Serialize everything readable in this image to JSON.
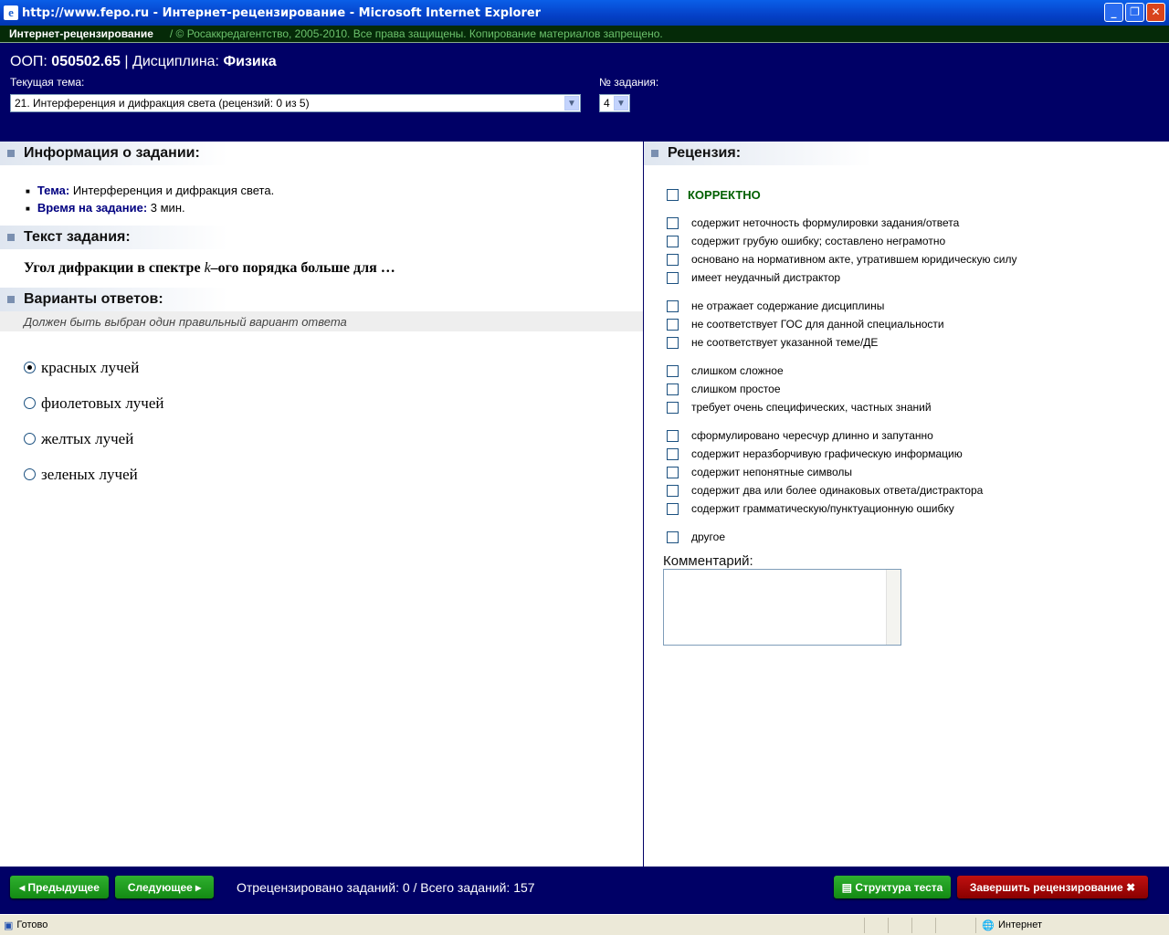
{
  "window": {
    "title": "http://www.fepo.ru - Интернет-рецензирование - Microsoft Internet Explorer"
  },
  "topbar": {
    "app": "Интернет-рецензирование",
    "copyright": "/ © Росаккредагентство, 2005-2010. Все права защищены. Копирование материалов запрещено."
  },
  "header": {
    "oop_label": "ООП:",
    "oop": "050502.65",
    "sep": "|",
    "disc_label": "Дисциплина:",
    "disc": "Физика",
    "topic_label": "Текущая тема:",
    "topic": "21. Интерференция и дифракция света  (рецензий: 0 из 5)",
    "task_label": "№ задания:",
    "task": "4"
  },
  "left": {
    "info_title": "Информация о задании:",
    "topic_key": "Тема:",
    "topic_val": "Интерференция и дифракция света.",
    "time_key": "Время на задание:",
    "time_val": "3 мин.",
    "text_title": "Текст задания:",
    "question_pre": "Угол дифракции в спектре ",
    "question_k": "k",
    "question_post": "–ого порядка больше для …",
    "answers_title": "Варианты ответов:",
    "hint": "Должен быть выбран один правильный вариант ответа",
    "options": [
      {
        "label": "красных лучей",
        "selected": true
      },
      {
        "label": "фиолетовых лучей",
        "selected": false
      },
      {
        "label": "желтых лучей",
        "selected": false
      },
      {
        "label": "зеленых лучей",
        "selected": false
      }
    ]
  },
  "review": {
    "title": "Рецензия:",
    "correct": "КОРРЕКТНО",
    "groups": [
      [
        "содержит неточность формулировки задания/ответа",
        "содержит грубую ошибку; составлено неграмотно",
        "основано на нормативном акте, утратившем юридическую силу",
        "имеет неудачный дистрактор"
      ],
      [
        "не отражает содержание дисциплины",
        "не соответствует ГОС для данной специальности",
        "не соответствует указанной теме/ДЕ"
      ],
      [
        "слишком сложное",
        "слишком простое",
        "требует очень специфических, частных знаний"
      ],
      [
        "сформулировано чересчур длинно и запутанно",
        "содержит неразборчивую графическую информацию",
        "содержит непонятные символы",
        "содержит два или более одинаковых ответа/дистрактора",
        "содержит грамматическую/пунктуационную ошибку"
      ],
      [
        "другое"
      ]
    ],
    "comment_label": "Комментарий:"
  },
  "footer": {
    "prev": "Предыдущее",
    "next": "Следующее",
    "count": "Отрецензировано заданий: 0 / Всего заданий: 157",
    "structure": "Структура теста",
    "finish": "Завершить рецензирование"
  },
  "status": {
    "ready": "Готово",
    "zone": "Интернет"
  }
}
